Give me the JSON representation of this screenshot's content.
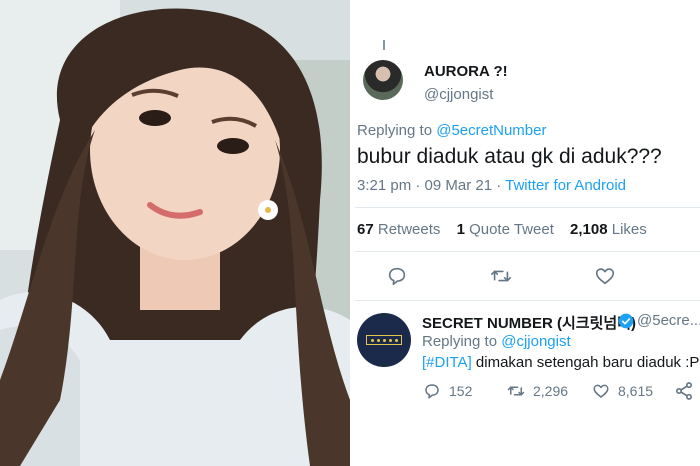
{
  "colors": {
    "accent": "#1da1f2",
    "muted": "#657786",
    "text": "#14171a",
    "divider": "#e1e8ed",
    "verified": "#1da1f2",
    "logo_bg": "#1b2a4a",
    "logo_gold": "#e8c64a"
  },
  "tweet": {
    "author_name": "AURORA ?!",
    "author_handle": "@cjjongist",
    "replying_label": "Replying to ",
    "replying_handle": "@5ecretNumber",
    "text": "bubur diaduk atau gk di aduk???",
    "time": "3:21 pm · 09 Mar 21 · ",
    "source": "Twitter for Android",
    "stats": {
      "retweets_count": "67",
      "retweets_label": "Retweets",
      "quotes_count": "1",
      "quotes_label": "Quote Tweet",
      "likes_count": "2,108",
      "likes_label": "Likes"
    },
    "actions": [
      "reply-icon",
      "retweet-icon",
      "like-icon"
    ]
  },
  "reply": {
    "author_name": "SECRET NUMBER (시크릿넘버)",
    "author_handle": "@5ecre...",
    "replying_label": "Replying to ",
    "replying_handle": "@cjjongist",
    "hashtag": "[#DITA]",
    "text": " dimakan setengah baru diaduk :P",
    "replies": "152",
    "retweets": "2,296",
    "likes": "8,615"
  }
}
